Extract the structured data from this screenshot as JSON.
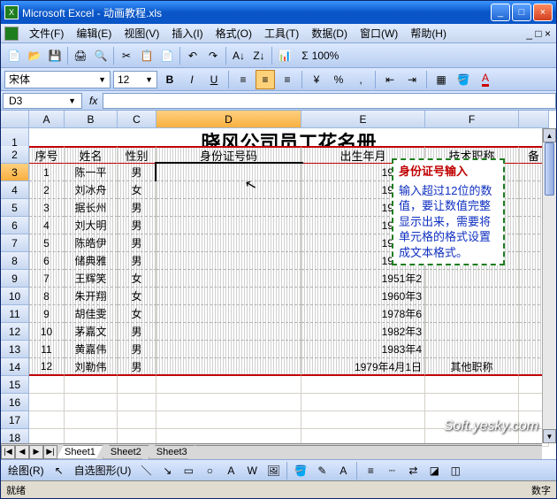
{
  "window": {
    "title": "Microsoft Excel - 动画教程.xls"
  },
  "menu": {
    "items": [
      "文件(F)",
      "编辑(E)",
      "视图(V)",
      "插入(I)",
      "格式(O)",
      "工具(T)",
      "数据(D)",
      "窗口(W)",
      "帮助(H)"
    ]
  },
  "format_bar": {
    "font_name": "宋体",
    "font_size": "12"
  },
  "namebox": {
    "cell_ref": "D3",
    "fx_label": "fx"
  },
  "columns": [
    "A",
    "B",
    "C",
    "D",
    "E",
    "F"
  ],
  "row_numbers": [
    1,
    2,
    3,
    4,
    5,
    6,
    7,
    8,
    9,
    10,
    11,
    12,
    13,
    14,
    15,
    16,
    17,
    18
  ],
  "sheet": {
    "title": "晓风公司员工花名册",
    "headers": {
      "A": "序号",
      "B": "姓名",
      "C": "性别",
      "D": "身份证号码",
      "E": "出生年月",
      "F": "技术职称",
      "G": "备"
    },
    "rows": [
      {
        "no": "1",
        "name": "陈一平",
        "sex": "男",
        "id": "",
        "dob": "1963年4",
        "title": ""
      },
      {
        "no": "2",
        "name": "刘冰舟",
        "sex": "女",
        "id": "",
        "dob": "1966年8",
        "title": ""
      },
      {
        "no": "3",
        "name": "据长州",
        "sex": "男",
        "id": "",
        "dob": "1970年8",
        "title": ""
      },
      {
        "no": "4",
        "name": "刘大明",
        "sex": "男",
        "id": "",
        "dob": "1963年2",
        "title": ""
      },
      {
        "no": "5",
        "name": "陈皓伊",
        "sex": "男",
        "id": "",
        "dob": "1984年3",
        "title": ""
      },
      {
        "no": "6",
        "name": "储典雅",
        "sex": "男",
        "id": "",
        "dob": "1980年1",
        "title": ""
      },
      {
        "no": "7",
        "name": "王辉笑",
        "sex": "女",
        "id": "",
        "dob": "1951年2",
        "title": ""
      },
      {
        "no": "8",
        "name": "朱开翔",
        "sex": "女",
        "id": "",
        "dob": "1960年3",
        "title": ""
      },
      {
        "no": "9",
        "name": "胡佳雯",
        "sex": "女",
        "id": "",
        "dob": "1978年6",
        "title": ""
      },
      {
        "no": "10",
        "name": "茅嘉文",
        "sex": "男",
        "id": "",
        "dob": "1982年3",
        "title": ""
      },
      {
        "no": "11",
        "name": "黄嘉伟",
        "sex": "男",
        "id": "",
        "dob": "1983年4",
        "title": ""
      },
      {
        "no": "12",
        "name": "刘勒伟",
        "sex": "男",
        "id": "",
        "dob": "1979年4月1日",
        "title": "其他职称"
      }
    ]
  },
  "tooltip": {
    "title": "身份证号输入",
    "body": "输入超过12位的数值，要让数值完整显示出来，需要将单元格的格式设置成文本格式。"
  },
  "sheets": {
    "tabs": [
      "Sheet1",
      "Sheet2",
      "Sheet3"
    ],
    "active": 0
  },
  "draw_toolbar": {
    "label": "绘图(R)",
    "autoshape": "自选图形(U)"
  },
  "statusbar": {
    "left": "就绪",
    "right": "数字"
  },
  "watermark": "Soft.yesky.com",
  "colors": {
    "accent": "#0a56c8",
    "border_red": "#c00000",
    "tip_green": "#1e7e1e",
    "tip_blue": "#1030c0"
  }
}
